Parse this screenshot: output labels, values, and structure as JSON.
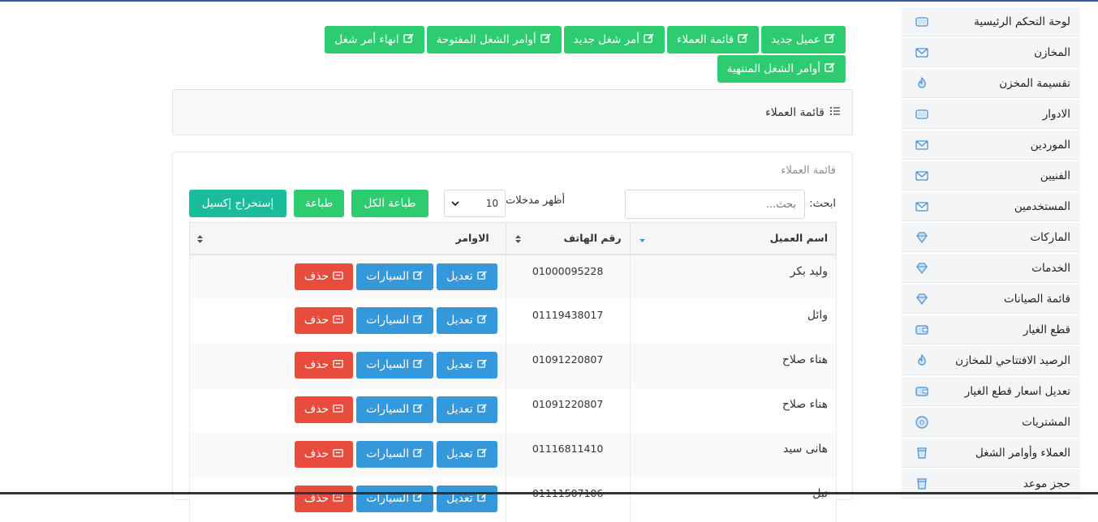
{
  "sidebar": {
    "items": [
      {
        "label": "لوحة التحكم الرئيسية",
        "icon": "wallet-icon"
      },
      {
        "label": "المخازن",
        "icon": "envelope-icon"
      },
      {
        "label": "تقسيمة المخزن",
        "icon": "fire-icon"
      },
      {
        "label": "الادوار",
        "icon": "wallet-icon"
      },
      {
        "label": "الموردين",
        "icon": "envelope-icon"
      },
      {
        "label": "الفنيين",
        "icon": "envelope-icon"
      },
      {
        "label": "المستخدمين",
        "icon": "envelope-icon"
      },
      {
        "label": "الماركات",
        "icon": "diamond-icon"
      },
      {
        "label": "الخدمات",
        "icon": "diamond-icon"
      },
      {
        "label": "قائمة الصيانات",
        "icon": "diamond-icon"
      },
      {
        "label": "قطع الغيار",
        "icon": "credit-card-icon"
      },
      {
        "label": "الرصيد الافتتاحي للمخازن",
        "icon": "fire-icon"
      },
      {
        "label": "تعديل اسعار قطع الغيار",
        "icon": "credit-card-icon"
      },
      {
        "label": "المشتريات",
        "icon": "disc-icon"
      },
      {
        "label": "العملاء وأوامر الشغل",
        "icon": "cup-icon"
      },
      {
        "label": "حجز موعد",
        "icon": "cup-icon"
      }
    ]
  },
  "top_buttons": [
    {
      "label": "عميل جديد"
    },
    {
      "label": "قائمة العملاء"
    },
    {
      "label": "أمر شغل جديد"
    },
    {
      "label": "أوامر الشغل المفتوحة"
    },
    {
      "label": "انهاء أمر شغل"
    },
    {
      "label": "أوامر الشغل المنتهية"
    }
  ],
  "breadcrumb": {
    "label": "قائمة العملاء"
  },
  "card": {
    "title": "قائمة العملاء",
    "search_label": "ابحث:",
    "search_placeholder": "بحث...",
    "length_label": "أظهر مدخلات",
    "length_value": "10",
    "btn_print_all": "طباعة الكل",
    "btn_print": "طباعة",
    "btn_excel": "إستخراج إكسيل"
  },
  "table": {
    "headers": {
      "name": "اسم العميل",
      "phone": "رقم الهاتف",
      "actions": "الاوامر"
    },
    "action_labels": {
      "edit": "تعديل",
      "cars": "السيارات",
      "delete": "حذف"
    },
    "rows": [
      {
        "name": "وليد بكر",
        "phone": "01000095228"
      },
      {
        "name": "وائل",
        "phone": "01119438017"
      },
      {
        "name": "هناء صلاح",
        "phone": "01091220807"
      },
      {
        "name": "هناء صلاح",
        "phone": "01091220807"
      },
      {
        "name": "هانى سيد",
        "phone": "01116811410"
      },
      {
        "name": "نبل",
        "phone": "01111507106"
      }
    ]
  },
  "colors": {
    "green": "#2ecc71",
    "teal": "#1abc9c",
    "blue": "#3498db",
    "red": "#e74c3c"
  }
}
